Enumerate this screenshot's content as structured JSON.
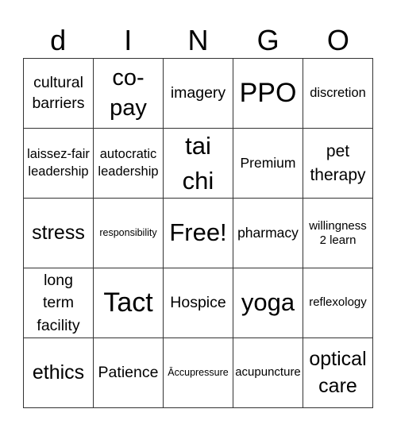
{
  "header": {
    "letters": [
      "d",
      "I",
      "N",
      "G",
      "O"
    ]
  },
  "cells": [
    [
      "cultural barriers",
      "co-pay",
      "imagery",
      "PPO",
      "discretion"
    ],
    [
      "laissez-fair leadership",
      "autocratic leadership",
      "tai chi",
      "Premium",
      "pet therapy"
    ],
    [
      "stress",
      "responsibility",
      "Free!",
      "pharmacy",
      "willingness 2 learn"
    ],
    [
      "long term facility",
      "Tact",
      "Hospice",
      "yoga",
      "reflexology"
    ],
    [
      "ethics",
      "Patience",
      "Āccupressure",
      "acupuncture",
      "optical care"
    ]
  ]
}
